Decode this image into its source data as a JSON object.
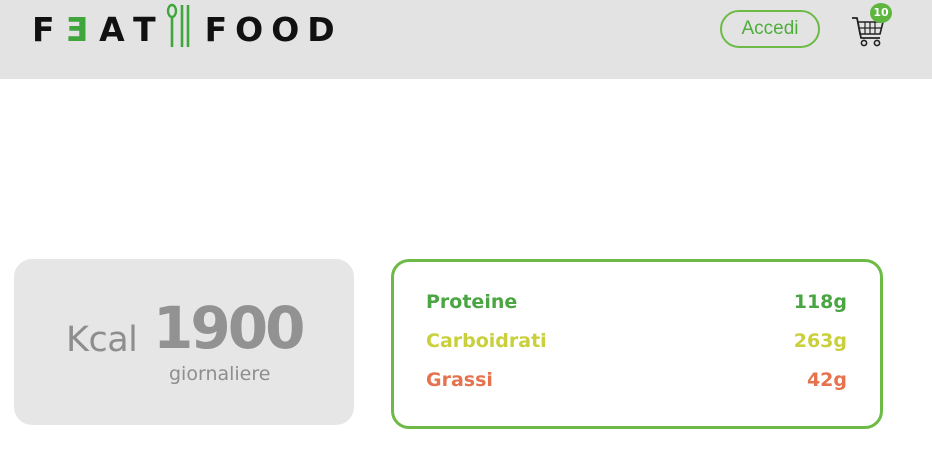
{
  "header": {
    "logo_part1": "F",
    "logo_mirrored_e": "E",
    "logo_part2": "AT",
    "logo_part3": "FOOD",
    "login_label": "Accedi",
    "cart_count": "10",
    "icons": [
      "fork-spoon-icon",
      "shopping-cart-icon"
    ]
  },
  "calories": {
    "unit": "Kcal",
    "value": "1900",
    "caption": "giornaliere"
  },
  "macros": [
    {
      "label": "Proteine",
      "value": "118g",
      "color": "#4aa542"
    },
    {
      "label": "Carboidrati",
      "value": "263g",
      "color": "#c9d03c"
    },
    {
      "label": "Grassi",
      "value": "42g",
      "color": "#e5734f"
    }
  ],
  "colors": {
    "header_bg": "#e3e3e3",
    "accent_green": "#6dbb46",
    "card_grey": "#e6e6e6",
    "text_grey": "#8e8e8e"
  }
}
